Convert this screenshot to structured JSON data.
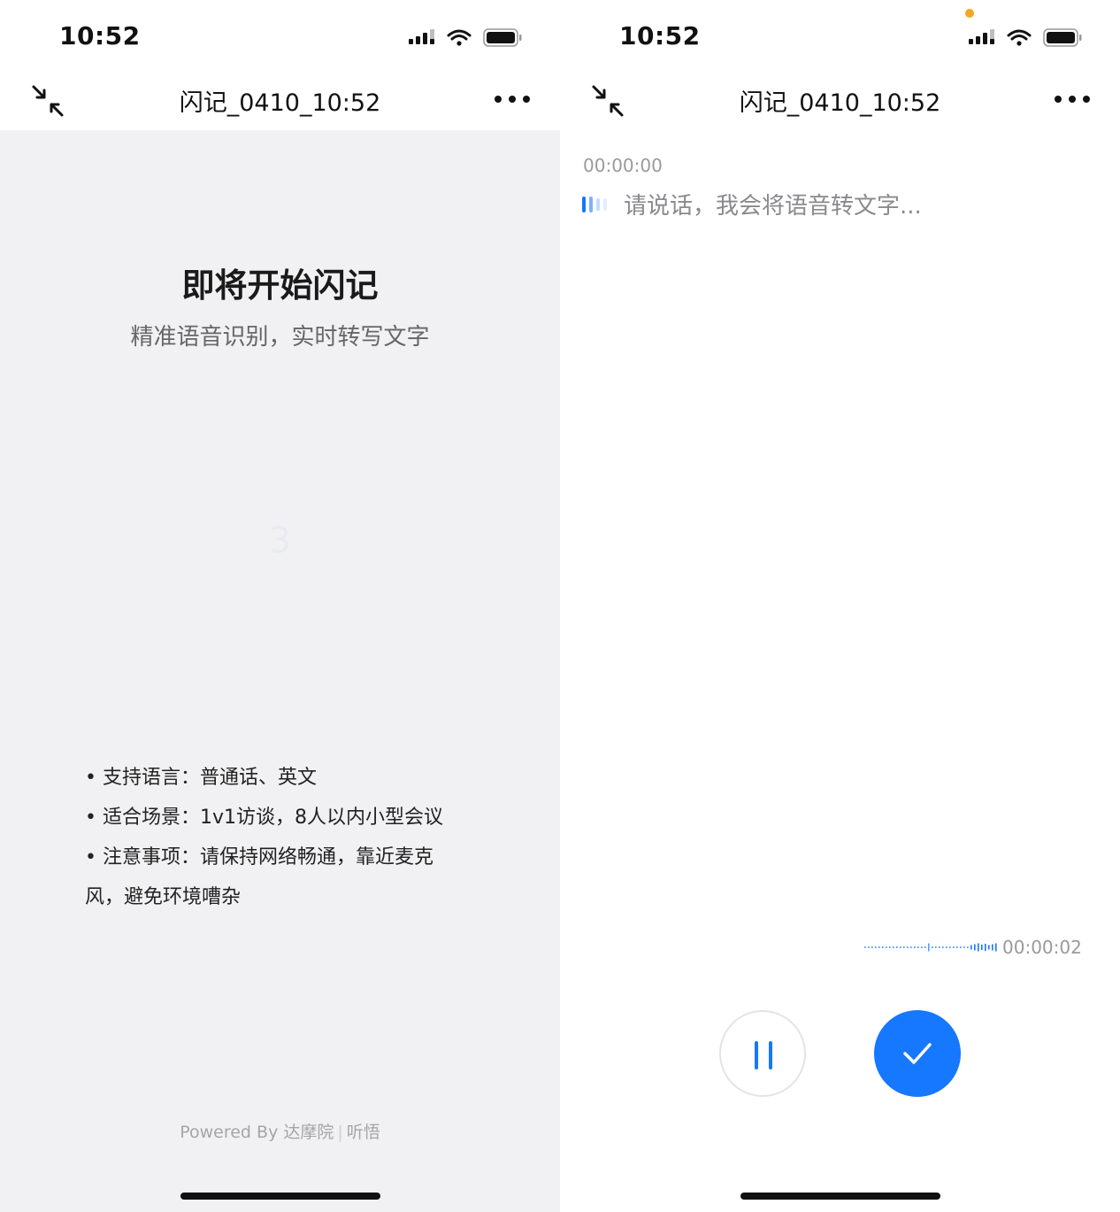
{
  "colors": {
    "accent": "#1677ff",
    "left_background": "#f1f1f3",
    "text_primary": "#111111",
    "text_muted": "#9a9a9e"
  },
  "left": {
    "status_bar": {
      "time": "10:52",
      "icons": [
        "signal-icon",
        "wifi-icon",
        "battery-icon"
      ]
    },
    "nav": {
      "minimize_icon": "minimize-icon",
      "title": "闪记_0410_10:52",
      "more_icon": "more-icon"
    },
    "hero": {
      "title": "即将开始闪记",
      "subtitle": "精准语音识别，实时转写文字"
    },
    "countdown": "3",
    "tips": [
      "• 支持语言：普通话、英文",
      "• 适合场景：1v1访谈，8人以内小型会议",
      "• 注意事项：请保持网络畅通，靠近麦克风，避免环境嘈杂"
    ],
    "footer": {
      "powered_prefix": "Powered By 达摩院",
      "powered_suffix": "听悟"
    }
  },
  "right": {
    "status_bar": {
      "time": "10:52",
      "icons": [
        "signal-icon",
        "wifi-icon",
        "battery-icon"
      ]
    },
    "nav": {
      "minimize_icon": "minimize-icon",
      "title": "闪记_0410_10:52",
      "more_icon": "more-icon"
    },
    "transcript": {
      "timestamp": "00:00:00",
      "placeholder": "请说话，我会将语音转文字..."
    },
    "recorder": {
      "elapsed": "00:00:02",
      "pause_icon": "pause-icon",
      "done_icon": "check-icon"
    }
  }
}
